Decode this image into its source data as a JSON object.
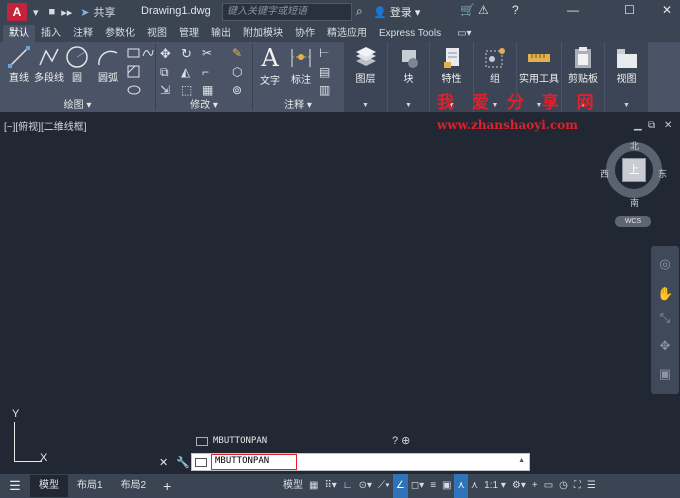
{
  "titlebar": {
    "logo": "A",
    "share": "共享",
    "doc_title": "Drawing1.dwg",
    "search_placeholder": "键入关键字或短语",
    "user": "登录"
  },
  "tabs": [
    "默认",
    "插入",
    "注释",
    "参数化",
    "视图",
    "管理",
    "输出",
    "附加模块",
    "协作",
    "精选应用",
    "Express Tools"
  ],
  "ribbon": {
    "draw": {
      "title": "绘图",
      "line": "直线",
      "polyline": "多段线",
      "circle": "圆",
      "arc": "圆弧"
    },
    "modify": {
      "title": "修改"
    },
    "annotation": {
      "title": "注释",
      "text": "文字",
      "dimension": "标注"
    },
    "layers": "图层",
    "block": "块",
    "properties": "特性",
    "groups": "组",
    "utilities": "实用工具",
    "clipboard": "剪贴板",
    "view": "视图"
  },
  "viewport": {
    "label": "[−][俯视][二维线框]",
    "watermark_cn": "我 爱 分 享 网",
    "watermark_url": "www.zhanshaoyi.com",
    "viewcube": {
      "top": "上",
      "north": "北",
      "south": "南",
      "east": "东",
      "west": "西",
      "wcs": "WCS"
    },
    "ucs": {
      "x": "X",
      "y": "Y"
    }
  },
  "command": {
    "history": "MBUTTONPAN",
    "input": "MBUTTONPAN"
  },
  "statusbar": {
    "tabs": [
      "模型",
      "布局1",
      "布局2"
    ],
    "model_label": "模型",
    "scale": "1:1"
  }
}
